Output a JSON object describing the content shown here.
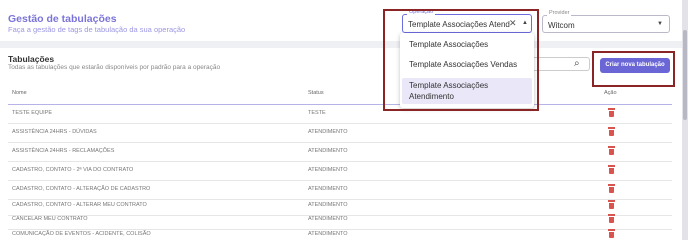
{
  "header": {
    "title": "Gestão de tabulações",
    "subtitle": "Faça a gestão de tags de tabulação da sua operação"
  },
  "operation_select": {
    "label": "Operação",
    "value": "Template Associações Atend",
    "options": [
      "Template Associações",
      "Template Associações Vendas",
      "Template Associações Atendimento"
    ],
    "selected_index": 2
  },
  "provider_select": {
    "label": "Provider",
    "value": "Witcom"
  },
  "section": {
    "title": "Tabulações",
    "subtitle": "Todas as tabulações que estarão disponíveis por padrão para a operação"
  },
  "create_button": "Criar nova tabulação",
  "table": {
    "columns": [
      "Nome",
      "Status",
      "Ação"
    ],
    "rows": [
      {
        "name": "TESTE EQUIPE",
        "status": "TESTE"
      },
      {
        "name": "ASSISTÊNCIA 24HRS - DÚVIDAS",
        "status": "ATENDIMENTO"
      },
      {
        "name": "ASSISTÊNCIA 24HRS - RECLAMAÇÕES",
        "status": "ATENDIMENTO"
      },
      {
        "name": "CADASTRO, CONTATO - 2ª VIA DO CONTRATO",
        "status": "ATENDIMENTO"
      },
      {
        "name": "CADASTRO, CONTATO - ALTERAÇÃO DE CADASTRO",
        "status": "ATENDIMENTO"
      },
      {
        "name": "CADASTRO, CONTATO - ALTERAR MEU CONTRATO",
        "status": "ATENDIMENTO"
      },
      {
        "name": "CANCELAR MEU CONTRATO",
        "status": "ATENDIMENTO"
      },
      {
        "name": "COMUNICAÇÃO DE EVENTOS - ACIDENTE, COLISÃO",
        "status": "ATENDIMENTO"
      }
    ]
  },
  "colors": {
    "accent": "#6b66d6",
    "title": "#7b74d8",
    "highlight_box": "#8b2525",
    "delete": "#d9534f"
  }
}
